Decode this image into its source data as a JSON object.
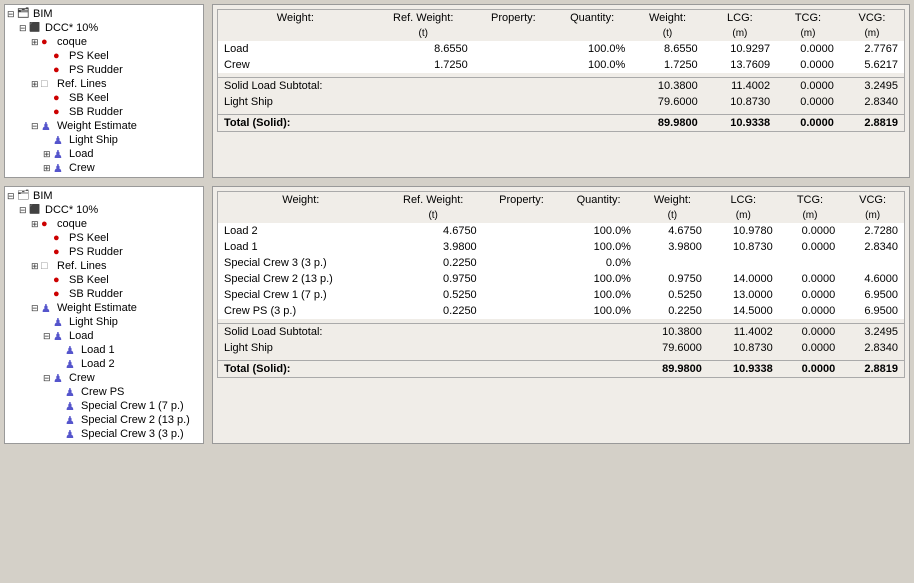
{
  "panel1": {
    "tree": {
      "items": [
        {
          "level": 0,
          "expand": "⊟",
          "icon": "bim",
          "label": "BIM"
        },
        {
          "level": 1,
          "expand": "⊟",
          "icon": "dcc",
          "label": "DCC* 10%"
        },
        {
          "level": 2,
          "expand": "⊞",
          "icon": "coque-red",
          "label": "coque"
        },
        {
          "level": 3,
          "expand": "",
          "icon": "keel-red",
          "label": "PS Keel"
        },
        {
          "level": 3,
          "expand": "",
          "icon": "rudder-red",
          "label": "PS Rudder"
        },
        {
          "level": 2,
          "expand": "⊞",
          "icon": "reflines-yellow",
          "label": "Ref. Lines"
        },
        {
          "level": 3,
          "expand": "",
          "icon": "keel-red",
          "label": "SB Keel"
        },
        {
          "level": 3,
          "expand": "",
          "icon": "rudder-red",
          "label": "SB Rudder"
        },
        {
          "level": 2,
          "expand": "⊟",
          "icon": "weight-blue",
          "label": "Weight Estimate"
        },
        {
          "level": 3,
          "expand": "",
          "icon": "person-blue",
          "label": "Light Ship"
        },
        {
          "level": 3,
          "expand": "⊞",
          "icon": "person-blue",
          "label": "Load"
        },
        {
          "level": 3,
          "expand": "⊞",
          "icon": "person-blue",
          "label": "Crew"
        }
      ]
    },
    "table": {
      "headers": [
        "Weight:",
        "Ref. Weight:",
        "Property:",
        "Quantity:",
        "Weight:",
        "LCG:",
        "TCG:",
        "VCG:"
      ],
      "subheaders": [
        "",
        "(t)",
        "",
        "",
        "(t)",
        "(m)",
        "(m)",
        "(m)"
      ],
      "rows": [
        {
          "label": "Load",
          "ref_weight": "8.6550",
          "property": "",
          "quantity": "100.0%",
          "weight": "8.6550",
          "lcg": "10.9297",
          "tcg": "0.0000",
          "vcg": "2.7767"
        },
        {
          "label": "Crew",
          "ref_weight": "1.7250",
          "property": "",
          "quantity": "100.0%",
          "weight": "1.7250",
          "lcg": "13.7609",
          "tcg": "0.0000",
          "vcg": "5.6217"
        }
      ],
      "subtotal": {
        "label": "Solid Load Subtotal:",
        "weight": "10.3800",
        "lcg": "11.4002",
        "tcg": "0.0000",
        "vcg": "3.2495"
      },
      "lightship": {
        "label": "Light Ship",
        "weight": "79.6000",
        "lcg": "10.8730",
        "tcg": "0.0000",
        "vcg": "2.8340"
      },
      "total": {
        "label": "Total (Solid):",
        "weight": "89.9800",
        "lcg": "10.9338",
        "tcg": "0.0000",
        "vcg": "2.8819"
      }
    }
  },
  "panel2": {
    "tree": {
      "items": [
        {
          "level": 0,
          "expand": "⊟",
          "icon": "bim",
          "label": "BIM"
        },
        {
          "level": 1,
          "expand": "⊟",
          "icon": "dcc",
          "label": "DCC* 10%"
        },
        {
          "level": 2,
          "expand": "⊞",
          "icon": "coque-red",
          "label": "coque"
        },
        {
          "level": 3,
          "expand": "",
          "icon": "keel-red",
          "label": "PS Keel"
        },
        {
          "level": 3,
          "expand": "",
          "icon": "rudder-red",
          "label": "PS Rudder"
        },
        {
          "level": 2,
          "expand": "⊞",
          "icon": "reflines-yellow",
          "label": "Ref. Lines"
        },
        {
          "level": 3,
          "expand": "",
          "icon": "keel-red",
          "label": "SB Keel"
        },
        {
          "level": 3,
          "expand": "",
          "icon": "rudder-red",
          "label": "SB Rudder"
        },
        {
          "level": 2,
          "expand": "⊟",
          "icon": "weight-blue",
          "label": "Weight Estimate"
        },
        {
          "level": 3,
          "expand": "",
          "icon": "person-blue",
          "label": "Light Ship"
        },
        {
          "level": 3,
          "expand": "⊟",
          "icon": "person-blue",
          "label": "Load"
        },
        {
          "level": 4,
          "expand": "",
          "icon": "person-blue",
          "label": "Load 1"
        },
        {
          "level": 4,
          "expand": "",
          "icon": "person-blue",
          "label": "Load 2"
        },
        {
          "level": 3,
          "expand": "⊟",
          "icon": "person-blue",
          "label": "Crew"
        },
        {
          "level": 4,
          "expand": "",
          "icon": "person-blue",
          "label": "Crew PS"
        },
        {
          "level": 4,
          "expand": "",
          "icon": "person-blue",
          "label": "Special Crew 1 (7 p.)"
        },
        {
          "level": 4,
          "expand": "",
          "icon": "person-blue",
          "label": "Special Crew 2 (13 p.)"
        },
        {
          "level": 4,
          "expand": "",
          "icon": "person-blue",
          "label": "Special Crew 3 (3 p.)"
        }
      ]
    },
    "table": {
      "headers": [
        "Weight:",
        "Ref. Weight:",
        "Property:",
        "Quantity:",
        "Weight:",
        "LCG:",
        "TCG:",
        "VCG:"
      ],
      "subheaders": [
        "",
        "(t)",
        "",
        "",
        "(t)",
        "(m)",
        "(m)",
        "(m)"
      ],
      "rows": [
        {
          "label": "Load 2",
          "ref_weight": "4.6750",
          "property": "",
          "quantity": "100.0%",
          "weight": "4.6750",
          "lcg": "10.9780",
          "tcg": "0.0000",
          "vcg": "2.7280"
        },
        {
          "label": "Load 1",
          "ref_weight": "3.9800",
          "property": "",
          "quantity": "100.0%",
          "weight": "3.9800",
          "lcg": "10.8730",
          "tcg": "0.0000",
          "vcg": "2.8340"
        },
        {
          "label": "Special Crew 3 (3 p.)",
          "ref_weight": "0.2250",
          "property": "",
          "quantity": "0.0%",
          "weight": "",
          "lcg": "",
          "tcg": "",
          "vcg": ""
        },
        {
          "label": "Special Crew 2 (13 p.)",
          "ref_weight": "0.9750",
          "property": "",
          "quantity": "100.0%",
          "weight": "0.9750",
          "lcg": "14.0000",
          "tcg": "0.0000",
          "vcg": "4.6000"
        },
        {
          "label": "Special Crew 1 (7 p.)",
          "ref_weight": "0.5250",
          "property": "",
          "quantity": "100.0%",
          "weight": "0.5250",
          "lcg": "13.0000",
          "tcg": "0.0000",
          "vcg": "6.9500"
        },
        {
          "label": "Crew PS (3 p.)",
          "ref_weight": "0.2250",
          "property": "",
          "quantity": "100.0%",
          "weight": "0.2250",
          "lcg": "14.5000",
          "tcg": "0.0000",
          "vcg": "6.9500"
        }
      ],
      "subtotal": {
        "label": "Solid Load Subtotal:",
        "weight": "10.3800",
        "lcg": "11.4002",
        "tcg": "0.0000",
        "vcg": "3.2495"
      },
      "lightship": {
        "label": "Light Ship",
        "weight": "79.6000",
        "lcg": "10.8730",
        "tcg": "0.0000",
        "vcg": "2.8340"
      },
      "total": {
        "label": "Total (Solid):",
        "weight": "89.9800",
        "lcg": "10.9338",
        "tcg": "0.0000",
        "vcg": "2.8819"
      }
    }
  }
}
